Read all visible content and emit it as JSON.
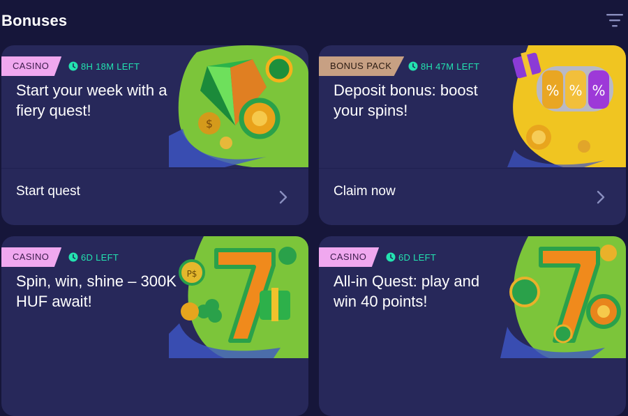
{
  "header": {
    "title": "Bonuses",
    "filter_icon": "filter-icon"
  },
  "cards": [
    {
      "tag": "CASINO",
      "timer": "8H 18M LEFT",
      "title": "Start your week with a fiery quest!",
      "cta": "Start quest",
      "art": "gem-and-coins"
    },
    {
      "tag": "BONUS PACK",
      "timer": "8H 47M LEFT",
      "title": "Deposit bonus: boost your spins!",
      "cta": "Claim now",
      "art": "slot-reels-gift"
    },
    {
      "tag": "CASINO",
      "timer": "6D LEFT",
      "title": "Spin, win, shine – 300K HUF await!",
      "cta": "",
      "art": "lucky-seven-gift"
    },
    {
      "tag": "CASINO",
      "timer": "6D LEFT",
      "title": "All-in Quest: play and win 40 points!",
      "cta": "",
      "art": "lucky-seven-chips"
    }
  ],
  "colors": {
    "background": "#16163a",
    "card": "#27285a",
    "timer": "#23e3b0",
    "tag_casino": "#f0a8ef",
    "tag_pack": "#c7a083"
  }
}
